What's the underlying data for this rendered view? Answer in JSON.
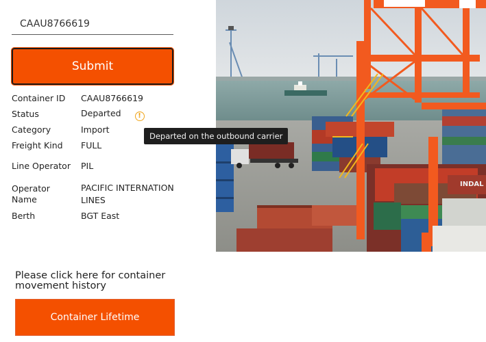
{
  "search": {
    "value": "CAAU8766619",
    "placeholder": ""
  },
  "submit_label": "Submit",
  "details": [
    {
      "label": "Container ID",
      "value": "CAAU8766619"
    },
    {
      "label": "Status",
      "value": "Departed"
    },
    {
      "label": "Category",
      "value": "Import"
    },
    {
      "label": "Freight Kind",
      "value": "FULL"
    },
    {
      "label": "Line Operator",
      "value": "PIL"
    },
    {
      "label": "Operator Name",
      "value": "PACIFIC INTERNATION LINES"
    },
    {
      "label": "Berth",
      "value": "BGT East"
    }
  ],
  "status_icon": "info-warning-icon",
  "tooltip": "Departed on the outbound carrier",
  "photo_container_text": "INDAL",
  "history_text": "Please click here for container movement history",
  "lifetime_label": "Container Lifetime",
  "colors": {
    "accent": "#f45000",
    "icon": "#f0a418",
    "tooltip_bg": "#1e1e1e"
  }
}
